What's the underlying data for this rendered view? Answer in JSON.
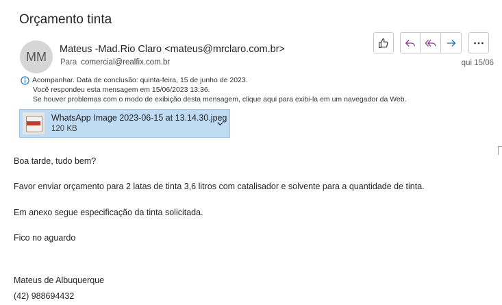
{
  "email": {
    "subject": "Orçamento tinta",
    "avatar_initials": "MM",
    "sender": "Mateus -Mad.Rio Claro <mateus@mrclaro.com.br>",
    "to_label": "Para",
    "to_value": "comercial@realfix.com.br",
    "date": "qui 15/06"
  },
  "actions": {
    "like_icon": "thumbs-up-icon",
    "reply_icon": "reply-icon",
    "reply_all_icon": "reply-all-icon",
    "forward_icon": "forward-icon",
    "more_icon": "more-icon"
  },
  "info": {
    "line1": "Acompanhar.  Data de conclusão: quinta-feira, 15 de junho de 2023.",
    "line2": "Você respondeu esta mensagem em 15/06/2023 13:36.",
    "line3": "Se houver problemas com o modo de exibição desta mensagem, clique aqui para exibi-la em um navegador da Web."
  },
  "attachment": {
    "name": "WhatsApp Image 2023-06-15 at 13.14.30.jpeg",
    "size": "120 KB"
  },
  "body": {
    "greeting": "Boa tarde, tudo bem?",
    "request": "Favor enviar orçamento para 2 latas de tinta 3,6 litros com catalisador e solvente para a quantidade de tinta.",
    "attachment_note": "Em anexo segue especificação da tinta solicitada.",
    "closing": "Fico no aguardo",
    "signature_name": "Mateus de Albuquerque",
    "signature_phone": "(42) 988694432"
  },
  "colors": {
    "accent": "#0f6cbd",
    "attachment_bg": "#bfdcf4"
  }
}
